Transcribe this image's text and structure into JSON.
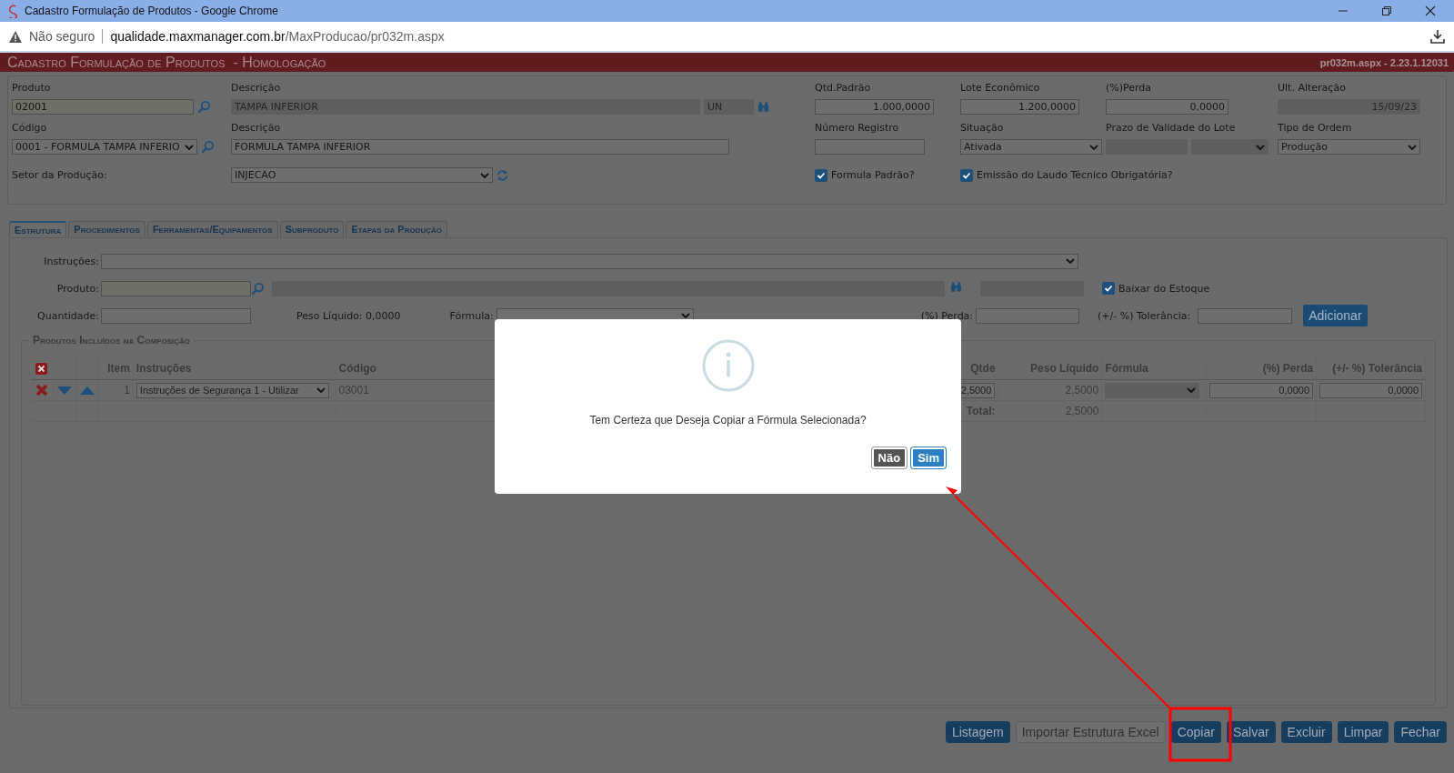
{
  "window": {
    "title": "Cadastro Formulação de Produtos - Google Chrome",
    "security": "Não seguro",
    "url_host": "qualidade.maxmanager.com.br",
    "url_path": "/MaxProducao/pr032m.aspx"
  },
  "header": {
    "title": "Cadastro Formulação de Produtos",
    "environment": "- Homologação",
    "version": "pr032m.aspx - 2.23.1.12031"
  },
  "form": {
    "produto": {
      "label": "Produto",
      "value": "02001",
      "disabled": false
    },
    "descricao": {
      "label": "Descrição",
      "value": "TAMPA INFERIOR",
      "unit": "UN",
      "disabled": true
    },
    "qtd_padrao": {
      "label": "Qtd.Padrão",
      "value": "1.000,0000",
      "disabled": false
    },
    "lote_economico": {
      "label": "Lote Econômico",
      "value": "1.200,0000",
      "disabled": false
    },
    "perda": {
      "label": "(%)Perda",
      "value": "0,0000",
      "disabled": false
    },
    "ult_alteracao": {
      "label": "Ult. Alteração",
      "value": "15/09/23",
      "disabled": true
    },
    "codigo": {
      "label": "Código",
      "value": "0001 - FORMULA TAMPA INFERIO",
      "disabled": false
    },
    "descricao_formula": {
      "label": "Descrição",
      "value": "FORMULA TAMPA INFERIOR",
      "disabled": false
    },
    "numero_registro": {
      "label": "Número Registro",
      "disabled": false
    },
    "situacao": {
      "label": "Situação",
      "value": "Ativada",
      "disabled": false
    },
    "prazo_validade": {
      "label": "Prazo de Validade do Lote",
      "disabled": true
    },
    "tipo_ordem": {
      "label": "Tipo de Ordem",
      "value": "Produção",
      "disabled": false
    },
    "setor": {
      "label": "Setor da Produção:",
      "value": "INJECAO",
      "disabled": false
    },
    "checks": [
      {
        "label": "Formula Padrão?",
        "checked": true
      },
      {
        "label": "Emissão do Laudo Técnico Obrigatória?",
        "checked": true
      }
    ]
  },
  "tabs": [
    {
      "label": "Estrutura",
      "selected": true
    },
    {
      "label": "Procedimentos",
      "selected": false
    },
    {
      "label": "Ferramentas/Equipamentos",
      "selected": false
    },
    {
      "label": "Subproduto",
      "selected": false
    },
    {
      "label": "Etapas da Produção",
      "selected": false
    }
  ],
  "entry": {
    "instrucoes_label": "Instruções:",
    "produto_label": "Produto:",
    "baixar": {
      "label": "Baixar do Estoque",
      "checked": true
    },
    "quantidade_label": "Quantidade:",
    "peso_liquido": "Peso Líquido: 0,0000",
    "formula_label": "Fórmula:",
    "perda_label": "(%) Perda:",
    "tolerancia_label": "(+/- %) Tolerância:",
    "add_button": "Adicionar"
  },
  "composition": {
    "legend": "Produtos Incluídos na Composição",
    "columns": [
      "Item",
      "Instruções",
      "Código",
      "Qtde",
      "Peso Líquido",
      "Fórmula",
      "(%) Perda",
      "(+/- %) Tolerância"
    ],
    "rows": [
      {
        "item": "1",
        "instrucoes": "Instruções de Segurança 1 - Utilizar",
        "codigo": "03001",
        "qtde": "2,5000",
        "peso": "2,5000",
        "perda": "0,0000",
        "tolerancia": "0,0000"
      }
    ],
    "total_label": "Total:",
    "total_peso": "2,5000"
  },
  "buttons": [
    {
      "label": "Listagem",
      "disabled": false
    },
    {
      "label": "Importar Estrutura Excel",
      "disabled": true
    },
    {
      "label": "Copiar",
      "disabled": false
    },
    {
      "label": "Salvar",
      "disabled": false
    },
    {
      "label": "Excluir",
      "disabled": false
    },
    {
      "label": "Limpar",
      "disabled": false
    },
    {
      "label": "Fechar",
      "disabled": false
    }
  ],
  "dialog": {
    "message": "Tem Certeza que Deseja Copiar a Fórmula Selecionada?",
    "buttons": [
      {
        "label": "Não",
        "kind": "secondary"
      },
      {
        "label": "Sim",
        "kind": "primary"
      }
    ]
  }
}
